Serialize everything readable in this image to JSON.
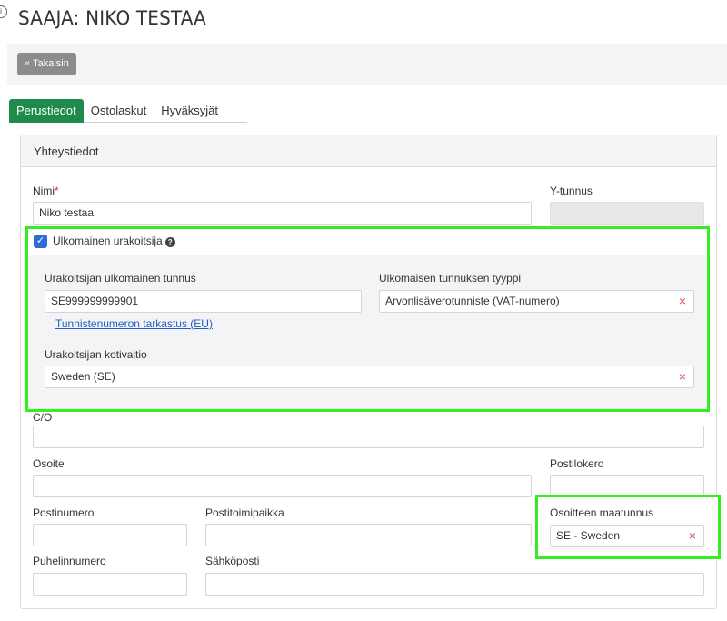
{
  "page": {
    "title": "SAAJA: NIKO TESTAA"
  },
  "toolbar": {
    "back_label": "Takaisin",
    "back_icon": "double-chevron-left-icon"
  },
  "tabs": [
    {
      "label": "Perustiedot",
      "active": true
    },
    {
      "label": "Ostolaskut",
      "active": false
    },
    {
      "label": "Hyväksyjät",
      "active": false
    }
  ],
  "panel": {
    "title": "Yhteystiedot"
  },
  "form": {
    "name_label": "Nimi",
    "name_required": "*",
    "name_value": "Niko testaa",
    "ytunnus_label": "Y-tunnus",
    "foreign_checkbox_label": "Ulkomainen urakoitsija",
    "foreign_checked": true,
    "foreign_id_label": "Urakoitsijan ulkomainen tunnus",
    "foreign_id_value": "SE999999999901",
    "foreign_id_type_label": "Ulkomaisen tunnuksen tyyppi",
    "foreign_id_type_value": "Arvonlisäverotunniste (VAT-numero)",
    "verify_link": "Tunnistenumeron tarkastus (EU)",
    "home_country_label": "Urakoitsijan kotivaltio",
    "home_country_value": "Sweden (SE)",
    "co_label": "C/O",
    "address_label": "Osoite",
    "pobox_label": "Postilokero",
    "postal_code_label": "Postinumero",
    "city_label": "Postitoimipaikka",
    "country_code_label": "Osoitteen maatunnus",
    "country_code_value": "SE - Sweden",
    "phone_label": "Puhelinnumero",
    "email_label": "Sähköposti"
  },
  "colors": {
    "active_tab": "#1e8a4c",
    "highlight": "#33ee22",
    "checkbox": "#2f6bd6",
    "link": "#1a5fc8",
    "clear": "#d9534f"
  }
}
